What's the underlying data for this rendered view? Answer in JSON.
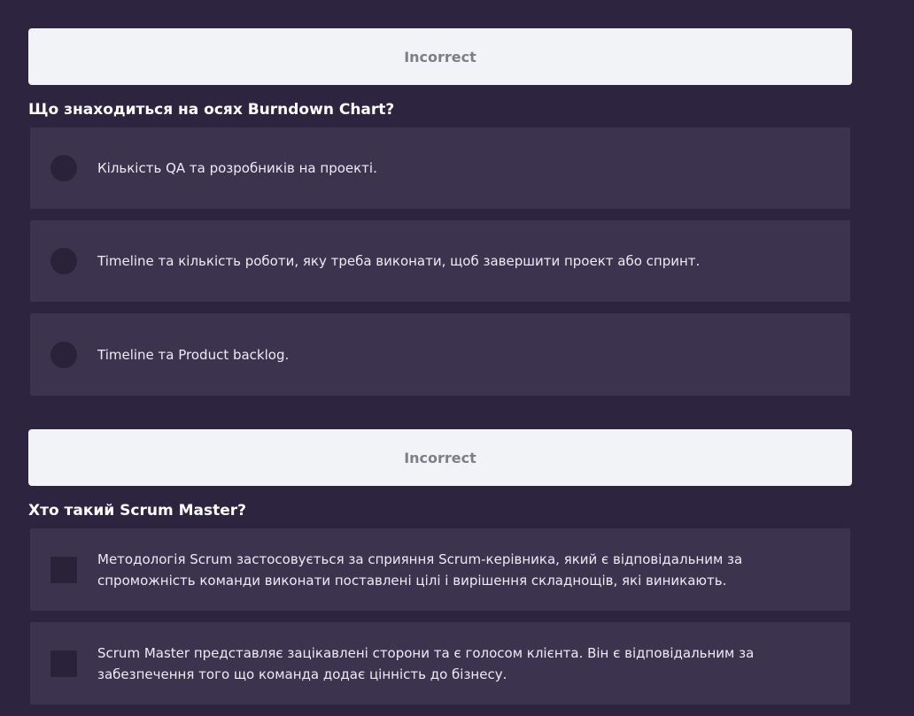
{
  "questions": [
    {
      "result": "Incorrect",
      "title": "Що знаходиться на осях Burndown Chart?",
      "input_type": "radio",
      "options": [
        "Кількість QA та розробників на проекті.",
        "Timeline та кількість роботи, яку треба виконати, щоб завершити проект або спринт.",
        "Timeline та Product backlog."
      ]
    },
    {
      "result": "Incorrect",
      "title": "Хто такий Scrum Master?",
      "input_type": "checkbox",
      "options": [
        "Методологія Scrum застосовується за сприяння Scrum-керівника, який є відповідальним за спроможність команди виконати поставлені цілі і вирішення складнощів, які виникають.",
        "Scrum Master представляє зацікавлені сторони та є голосом клієнта. Він є відповідальним за забезпечення того що команда додає цінність до бізнесу."
      ]
    }
  ],
  "colors": {
    "background": "#2d2540",
    "banner_bg": "#f2f3f6",
    "banner_text": "#7d7f86",
    "option_bg": "#3c344f",
    "marker_bg": "#2a2239"
  }
}
